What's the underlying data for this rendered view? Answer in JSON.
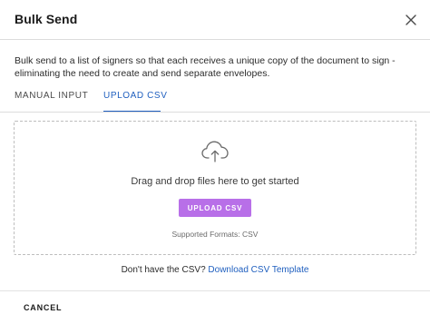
{
  "dialog": {
    "title": "Bulk Send",
    "description": "Bulk send to a list of signers so that each receives a unique copy of the document to sign - eliminating the need to create and send separate envelopes."
  },
  "tabs": [
    {
      "label": "MANUAL INPUT",
      "active": false
    },
    {
      "label": "UPLOAD CSV",
      "active": true
    }
  ],
  "dropzone": {
    "icon": "cloud-upload-icon",
    "prompt": "Drag and drop files here to get started",
    "button_label": "UPLOAD CSV",
    "supported_formats": "Supported Formats: CSV"
  },
  "template": {
    "question": "Don't have the CSV?",
    "link_label": "Download CSV Template"
  },
  "footer": {
    "cancel_label": "CANCEL"
  },
  "colors": {
    "accent": "#1f5fbf",
    "upload_button": "#b86fe8"
  }
}
